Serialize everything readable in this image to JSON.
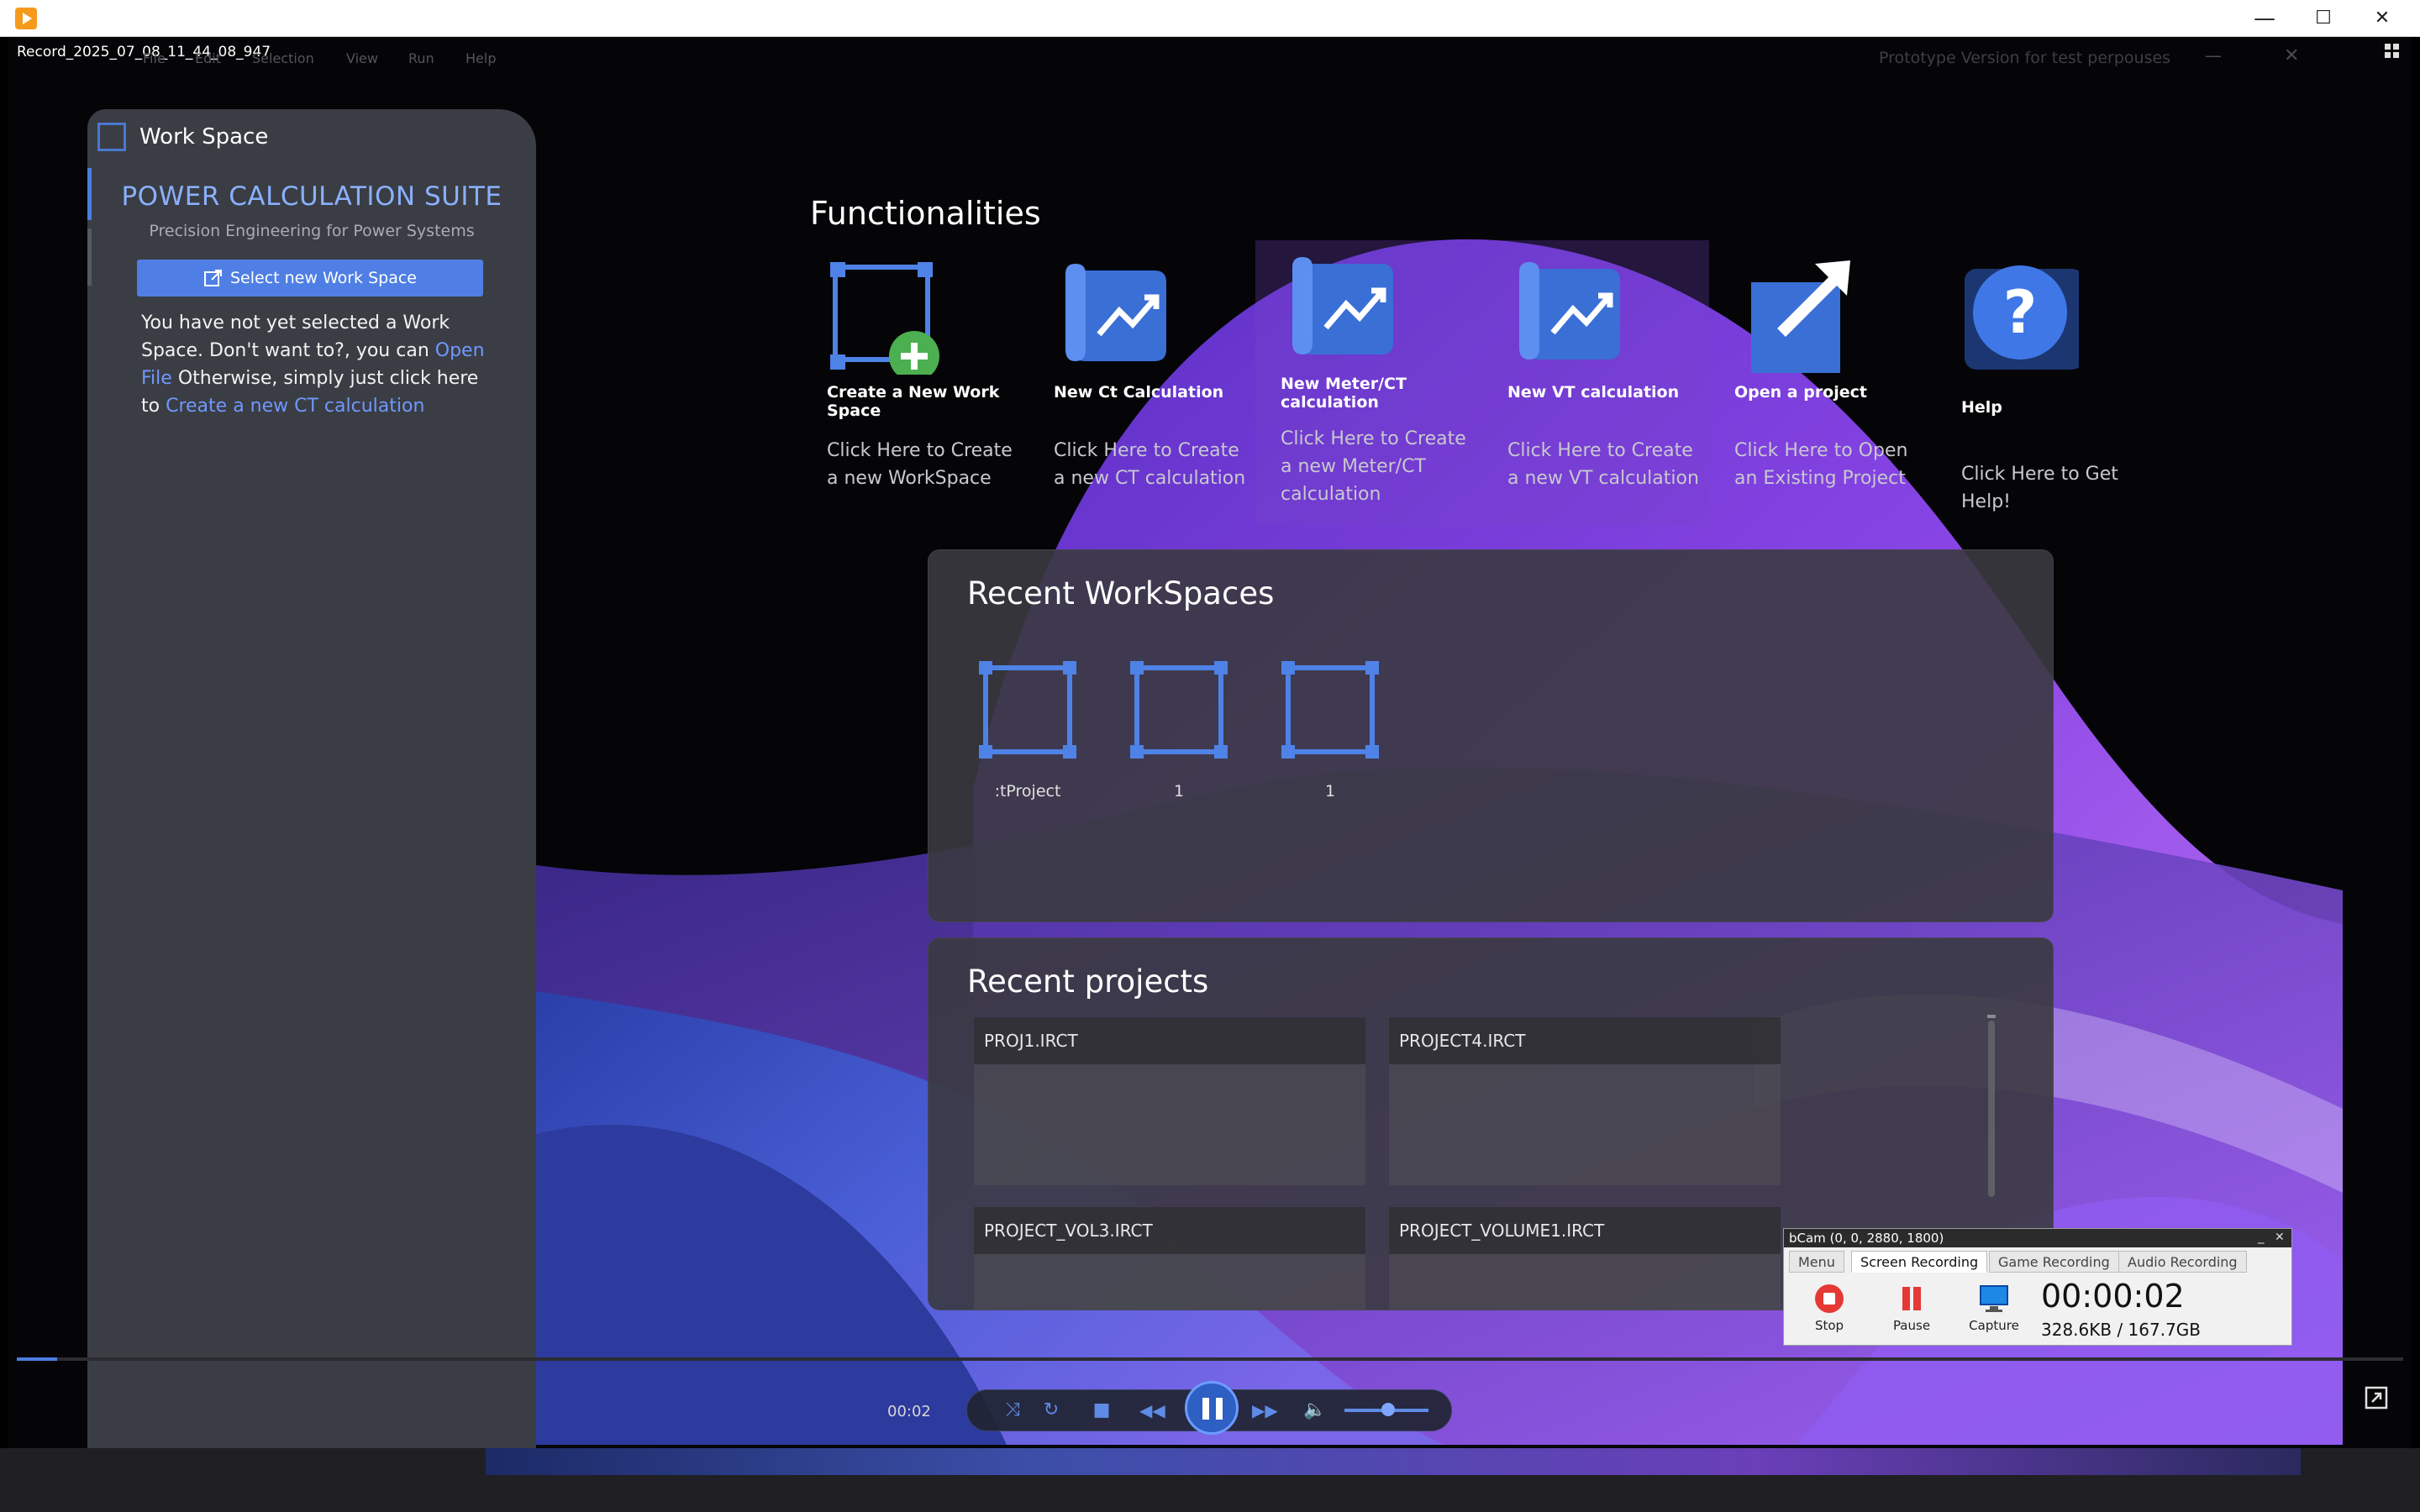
{
  "window": {
    "minimize_glyph": "—",
    "maximize_glyph": "☐",
    "close_glyph": "✕"
  },
  "player": {
    "recording_name": "Record_2025_07_08_11_44_08_947",
    "time_elapsed": "00:02",
    "progress_fraction": 0.017
  },
  "app": {
    "menubar": [
      "File",
      "Edit",
      "Selection",
      "View",
      "Run",
      "Help"
    ],
    "prototype_notice": "Prototype Version for test perpouses",
    "inner_min": "—",
    "inner_close": "✕"
  },
  "sidebar": {
    "title": "Work Space",
    "suite_title": "POWER CALCULATION SUITE",
    "suite_subtitle": "Precision Engineering for Power Systems",
    "select_button": "Select new Work Space",
    "message_prefix": "You have not yet selected a Work Space. Don't want to?, you can ",
    "open_file_link": "Open File",
    "message_mid": " Otherwise, simply just click here to ",
    "create_ct_link": "Create a new CT calculation"
  },
  "functionalities": {
    "heading": "Functionalities",
    "tiles": [
      {
        "name": "Create a New Work Space",
        "desc": "Click Here to Create a new WorkSpace",
        "icon": "workspace-add-icon"
      },
      {
        "name": "New Ct Calculation",
        "desc": "Click Here to Create a new CT calculation",
        "icon": "chart-document-icon"
      },
      {
        "name": "New Meter/CT calculation",
        "desc": "Click Here to Create a new Meter/CT calculation",
        "icon": "chart-document-icon"
      },
      {
        "name": "New VT calculation",
        "desc": "Click Here to Create a new VT calculation",
        "icon": "chart-document-icon"
      },
      {
        "name": "Open a project",
        "desc": "Click Here to Open an Existing Project",
        "icon": "open-external-icon"
      },
      {
        "name": "Help",
        "desc": "Click Here to Get Help!",
        "icon": "help-icon"
      }
    ]
  },
  "recent_workspaces": {
    "title": "Recent WorkSpaces",
    "items": [
      ":tProject",
      "1",
      "1"
    ]
  },
  "recent_projects": {
    "title": "Recent projects",
    "items": [
      "PROJ1.IRCT",
      "PROJECT4.IRCT",
      "PROJECT_VOL3.IRCT",
      "PROJECT_VOLUME1.IRCT"
    ]
  },
  "bandicam": {
    "title": "bCam (0, 0, 2880, 1800)",
    "tabs": [
      "Menu",
      "Screen Recording",
      "Game Recording",
      "Audio Recording"
    ],
    "active_tab": "Screen Recording",
    "buttons": [
      "Stop",
      "Pause",
      "Capture"
    ],
    "time": "00:00:02",
    "size": "328.6KB / 167.7GB",
    "close_glyph": "✕",
    "min_glyph": "_"
  },
  "colors": {
    "accent_blue": "#4f7fe4",
    "link_blue": "#6f98ff",
    "wallpaper_purple": "#7a3fe0"
  }
}
